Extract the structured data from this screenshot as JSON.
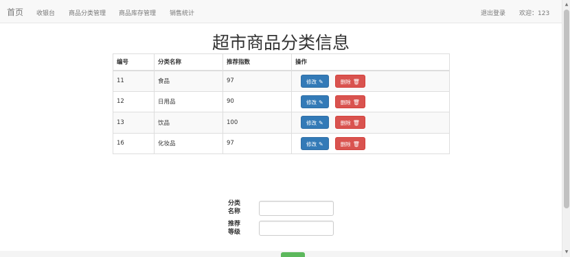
{
  "navbar": {
    "brand": "首页",
    "items": [
      "收银台",
      "商品分类管理",
      "商品库存管理",
      "销售统计"
    ],
    "logout": "退出登录",
    "welcome": "欢迎：123"
  },
  "page_title": "超市商品分类信息",
  "table": {
    "headers": [
      "编号",
      "分类名称",
      "推荐指数",
      "操作"
    ],
    "rows": [
      {
        "id": "11",
        "name": "食品",
        "index": "97"
      },
      {
        "id": "12",
        "name": "日用品",
        "index": "90"
      },
      {
        "id": "13",
        "name": "饮品",
        "index": "100"
      },
      {
        "id": "16",
        "name": "化妆品",
        "index": "97"
      }
    ],
    "edit_label": "修改",
    "delete_label": "删除"
  },
  "form": {
    "category_name_label": "分类名称",
    "category_name_line1": "分类",
    "category_name_line2": "名称",
    "rating_line1": "推荐",
    "rating_line2": "等级",
    "category_name_value": "",
    "rating_value": ""
  },
  "colors": {
    "edit_button": "#337ab7",
    "delete_button": "#d9534f",
    "submit_button": "#5cb85c"
  },
  "icons": {
    "edit": "pencil-icon",
    "delete": "trash-icon"
  }
}
